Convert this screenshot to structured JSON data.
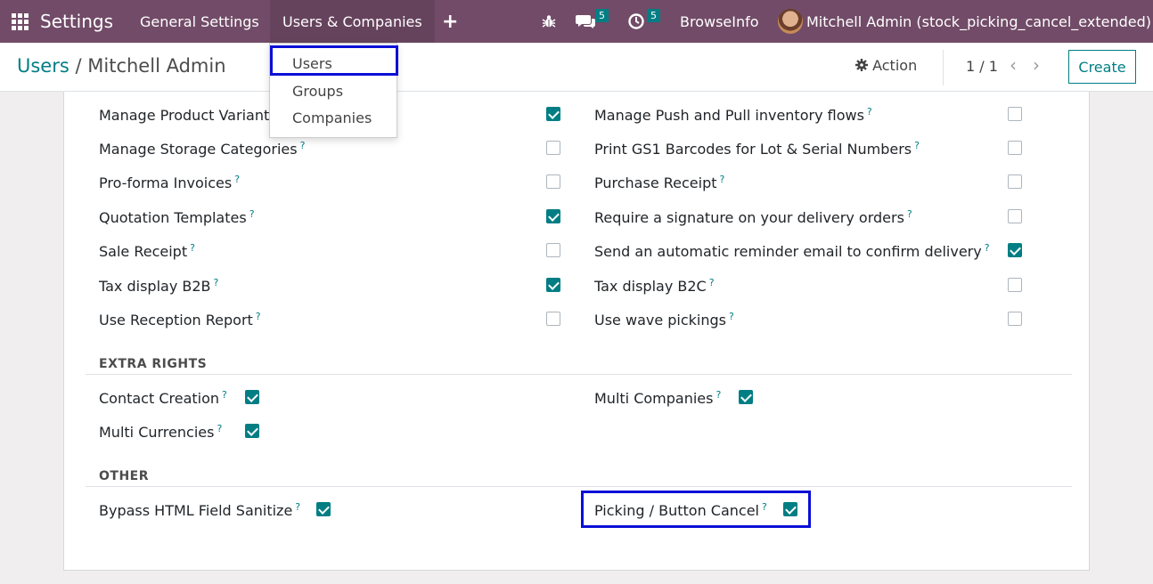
{
  "navbar": {
    "app_name": "Settings",
    "menu": [
      "General Settings",
      "Users & Companies"
    ],
    "add_icon": "+",
    "messages_count": "5",
    "activities_count": "5",
    "company": "BrowseInfo",
    "user": "Mitchell Admin (stock_picking_cancel_extended)",
    "icons": [
      "apps-grid-icon",
      "bug-icon",
      "chat-icon",
      "clock-icon"
    ]
  },
  "dropdown": {
    "items": [
      "Users",
      "Groups",
      "Companies"
    ]
  },
  "control_panel": {
    "breadcrumb_root": "Users",
    "breadcrumb_sep": "/",
    "breadcrumb_current": "Mitchell Admin",
    "action_label": "Action",
    "pager": "1 / 1",
    "create_label": "Create"
  },
  "rights_left": [
    {
      "label": "Manage Product Variants",
      "checked": true
    },
    {
      "label": "Manage Storage Categories",
      "checked": false
    },
    {
      "label": "Pro-forma Invoices",
      "checked": false
    },
    {
      "label": "Quotation Templates",
      "checked": true
    },
    {
      "label": "Sale Receipt",
      "checked": false
    },
    {
      "label": "Tax display B2B",
      "checked": true
    },
    {
      "label": "Use Reception Report",
      "checked": false
    }
  ],
  "rights_right": [
    {
      "label": "Manage Push and Pull inventory flows",
      "checked": false
    },
    {
      "label": "Print GS1 Barcodes for Lot & Serial Numbers",
      "checked": false
    },
    {
      "label": "Purchase Receipt",
      "checked": false
    },
    {
      "label": "Require a signature on your delivery orders",
      "checked": false
    },
    {
      "label": "Send an automatic reminder email to confirm delivery",
      "checked": true
    },
    {
      "label": "Tax display B2C",
      "checked": false
    },
    {
      "label": "Use wave pickings",
      "checked": false
    }
  ],
  "extra_rights": {
    "title": "EXTRA RIGHTS",
    "items": [
      {
        "label": "Contact Creation",
        "checked": true
      },
      {
        "label": "Multi Companies",
        "checked": true
      },
      {
        "label": "Multi Currencies",
        "checked": true
      }
    ]
  },
  "other": {
    "title": "OTHER",
    "items": [
      {
        "label": "Bypass HTML Field Sanitize",
        "checked": true
      },
      {
        "label": "Picking / Button Cancel",
        "checked": true
      }
    ]
  },
  "help_mark": "?",
  "colors": {
    "navbar": "#714b67",
    "accent": "#017e84",
    "highlight": "#0a0fd6"
  }
}
